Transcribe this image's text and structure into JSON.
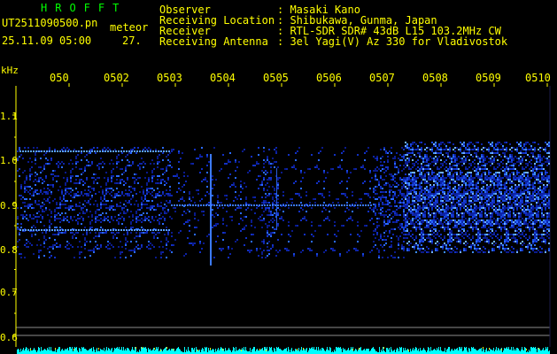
{
  "app": {
    "title": "HROFFT",
    "filename": "UT2511090500.pn",
    "mode": "meteor",
    "datetime": "25.11.09 05:00",
    "count": "27."
  },
  "info": {
    "observer_label": "Observer",
    "observer_value": ": Masaki Kano",
    "location_label": "Receiving Location",
    "location_value": ": Shibukawa, Gunma, Japan",
    "receiver_label": "Receiver",
    "receiver_value": ": RTL-SDR SDR# 43dB L15 103.2MHz CW",
    "antenna_label": "Receiving Antenna",
    "antenna_value": ": 3el Yagi(V) Az 330 for Vladivostok"
  },
  "axes": {
    "y_unit": "kHz",
    "y_ticks": [
      "1.1",
      "1.0",
      "0.9",
      "0.8",
      "0.7",
      "0.6"
    ],
    "x_ticks": [
      "050",
      "0502",
      "0503",
      "0504",
      "0505",
      "0506",
      "0507",
      "0508",
      "0509",
      "0510"
    ]
  },
  "colors": {
    "background": "#000000",
    "header_text": "#ffff00",
    "app_title": "#00ff00",
    "signal_low": "#0a1a8c",
    "signal_high": "#3d8dff",
    "strip": "#00ffff"
  }
}
